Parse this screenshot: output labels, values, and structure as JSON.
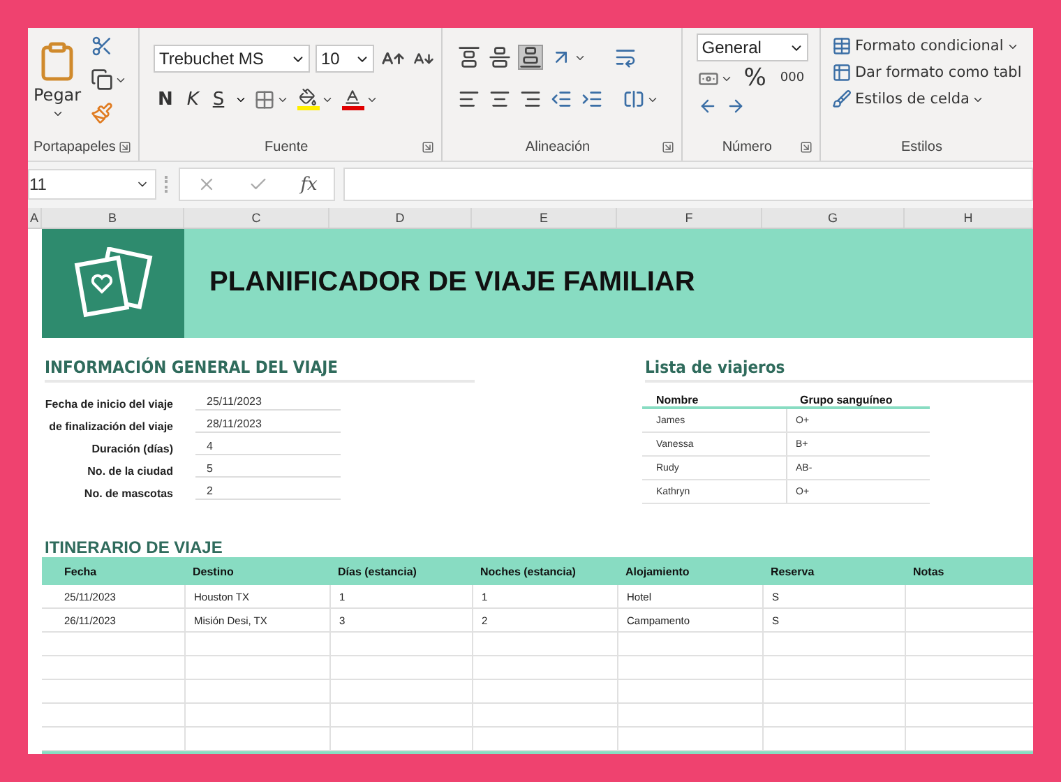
{
  "ribbon": {
    "clipboard": {
      "paste": "Pegar",
      "label": "Portapapeles"
    },
    "font": {
      "name": "Trebuchet MS",
      "size": "10",
      "bold": "N",
      "italic": "K",
      "underline": "S",
      "label": "Fuente"
    },
    "alignment": {
      "vertical": [
        {
          "kind": "top",
          "selected": false
        },
        {
          "kind": "middle",
          "selected": false
        },
        {
          "kind": "bottom",
          "selected": true
        }
      ],
      "label": "Alineación"
    },
    "number": {
      "format": "General",
      "percent": "%",
      "thousands": "000",
      "label": "Número"
    },
    "styles": {
      "items": [
        {
          "kind": "conditional",
          "label": "Formato condicional",
          "menu": true
        },
        {
          "kind": "table",
          "label": "Dar formato como tabl",
          "menu": false
        },
        {
          "kind": "cell",
          "label": "Estilos de celda",
          "menu": true
        }
      ],
      "label": "Estilos"
    }
  },
  "formula_bar": {
    "name_box": "11",
    "function_label": "fx"
  },
  "columns": [
    "A",
    "B",
    "C",
    "D",
    "E",
    "F",
    "G",
    "H"
  ],
  "banner": {
    "title": "PLANIFICADOR DE VIAJE FAMILIAR"
  },
  "general_info": {
    "title": "INFORMACIÓN GENERAL DEL VIAJE",
    "fields": [
      {
        "label": "Fecha de inicio del viaje",
        "value": "25/11/2023"
      },
      {
        "label": "de finalización del viaje",
        "value": "28/11/2023"
      },
      {
        "label": "Duración (días)",
        "value": "4"
      },
      {
        "label": "No. de la ciudad",
        "value": "5"
      },
      {
        "label": "No. de mascotas",
        "value": "2"
      }
    ]
  },
  "travelers": {
    "title": "Lista de viajeros",
    "columns": [
      "Nombre",
      "Grupo sanguíneo"
    ],
    "rows": [
      [
        "James",
        "O+"
      ],
      [
        "Vanessa",
        "B+"
      ],
      [
        "Rudy",
        "AB-"
      ],
      [
        "Kathryn",
        "O+"
      ]
    ]
  },
  "itinerary": {
    "title": "ITINERARIO DE VIAJE",
    "columns": [
      "Fecha",
      "Destino",
      "Días (estancia)",
      "Noches (estancia)",
      "Alojamiento",
      "Reserva",
      "Notas"
    ],
    "rows": [
      [
        "25/11/2023",
        "Houston TX",
        "1",
        "1",
        "Hotel",
        "S"
      ],
      [
        "26/11/2023",
        "Misión Desi, TX",
        "3",
        "2",
        "Campamento",
        "S"
      ]
    ]
  }
}
